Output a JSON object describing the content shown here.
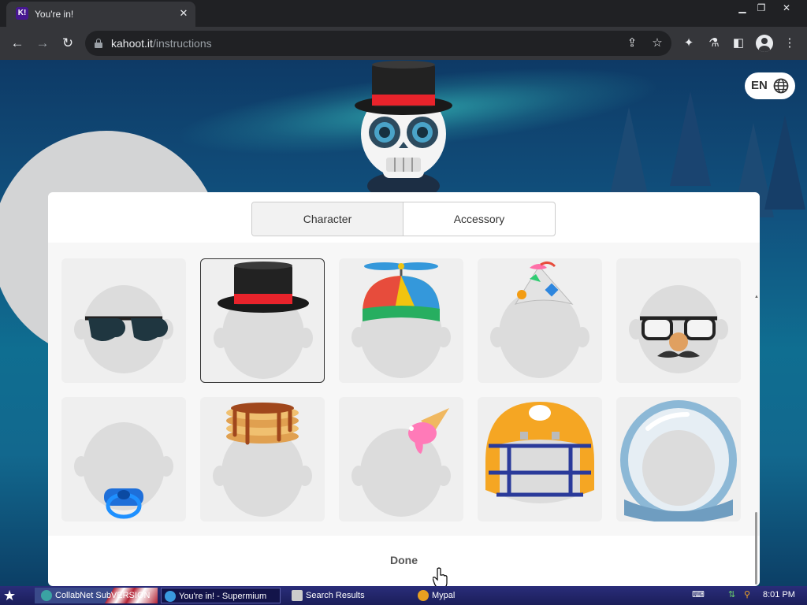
{
  "browser": {
    "tab_title": "You're in!",
    "favicon_text": "K!",
    "url_host": "kahoot.it",
    "url_path": "/instructions",
    "window_controls": [
      "minimize-icon",
      "restore-icon",
      "close-icon"
    ]
  },
  "page": {
    "language": "EN",
    "tabs": [
      {
        "label": "Character",
        "active": true
      },
      {
        "label": "Accessory",
        "active": false
      }
    ],
    "accessories": [
      {
        "name": "sunglasses"
      },
      {
        "name": "top-hat",
        "selected": true
      },
      {
        "name": "propeller-cap"
      },
      {
        "name": "party-hat"
      },
      {
        "name": "disguise-glasses"
      },
      {
        "name": "pacifier"
      },
      {
        "name": "pancakes"
      },
      {
        "name": "ice-cream-cone"
      },
      {
        "name": "football-helmet"
      },
      {
        "name": "astronaut-helmet"
      }
    ],
    "done_label": "Done"
  },
  "taskbar": {
    "items": [
      {
        "label": "CollabNet SubVERSION",
        "active": false
      },
      {
        "label": "You're in! - Supermium",
        "active": true
      },
      {
        "label": "Search Results",
        "active": false
      },
      {
        "label": "Mypal",
        "active": false
      }
    ],
    "clock": "8:01 PM"
  },
  "colors": {
    "kahoot_purple": "#46178f",
    "hat_red": "#e8232b",
    "sky_blue": "#0f6e91"
  }
}
